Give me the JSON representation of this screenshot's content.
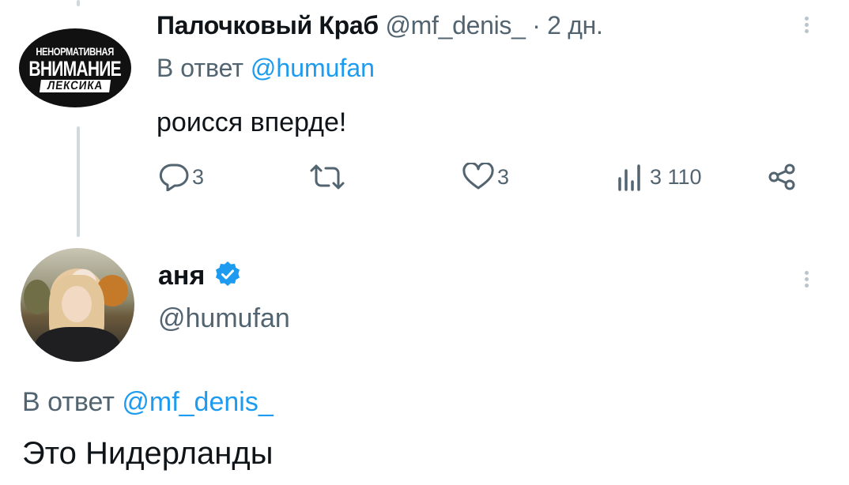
{
  "tweet1": {
    "avatar_text": [
      "НЕНОРМАТИВНАЯ",
      "ВНИМАНИЕ",
      "ЛЕКСИКА"
    ],
    "display_name": "Палочковый Краб",
    "handle": "@mf_denis_",
    "separator": "·",
    "time": "2 дн.",
    "reply_prefix": "В ответ",
    "reply_to": "@humufan",
    "text": "роисся вперде!",
    "actions": {
      "replies": "3",
      "retweets": "",
      "likes": "3",
      "views": "3 110"
    }
  },
  "tweet2": {
    "display_name": "аня",
    "verified": true,
    "handle": "@humufan",
    "reply_prefix": "В ответ",
    "reply_to": "@mf_denis_",
    "text": "Это Нидерланды"
  },
  "colors": {
    "accent": "#1d9bf0",
    "secondary_text": "#536471",
    "primary_text": "#0f1419",
    "thread_line": "#cfd9de"
  }
}
